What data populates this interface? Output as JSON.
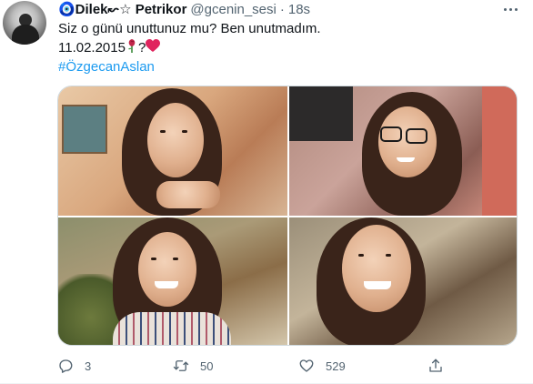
{
  "tweet": {
    "display_name": "🧿Dilek↜☆ Petrikor",
    "handle": "@gcenin_sesi",
    "separator": "·",
    "time": "18s",
    "text_line1": "Siz o günü unuttunuz mu? Ben unutmadım.",
    "text_line2": "11.02.2015",
    "text_line2_suffix": "?",
    "hashtag": "#ÖzgecanAslan"
  },
  "media": {
    "photo_count": 4
  },
  "actions": {
    "reply_count": "3",
    "retweet_count": "50",
    "like_count": "529"
  },
  "icons": {
    "reply": "reply-icon",
    "retweet": "retweet-icon",
    "like": "heart-icon",
    "share": "share-icon",
    "more": "more-icon",
    "rose": "rose-emoji-icon",
    "heart": "red-heart-emoji-icon"
  },
  "colors": {
    "hashtag": "#1d9bf0",
    "secondary_text": "#536471",
    "heart_emoji": "#e0245e"
  }
}
